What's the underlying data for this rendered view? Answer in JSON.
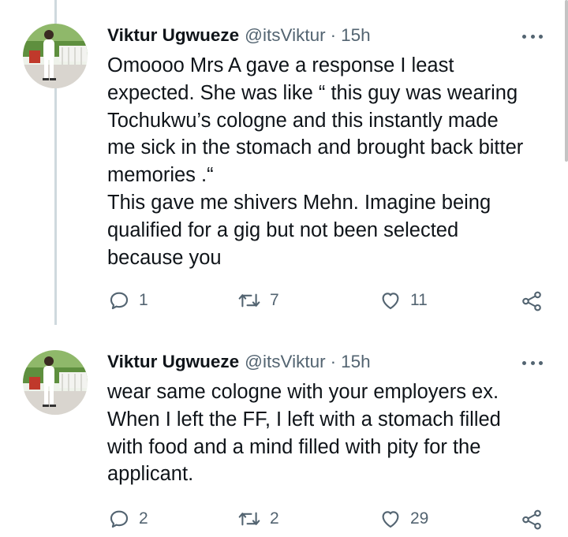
{
  "tweets": [
    {
      "author_name": "Viktur Ugwueze",
      "handle": "@itsViktur",
      "separator": "·",
      "time": "15h",
      "text_lines": [
        "Omoooo Mrs A gave a response I least",
        "expected. She was like “ this guy was wearing",
        "Tochukwu’s cologne and this instantly made",
        "me sick in the stomach and brought back bitter",
        "memories .“",
        "This gave me shivers Mehn. Imagine being",
        "qualified for a gig but not been selected",
        "because you"
      ],
      "replies": "1",
      "retweets": "7",
      "likes": "11"
    },
    {
      "author_name": "Viktur Ugwueze",
      "handle": "@itsViktur",
      "separator": "·",
      "time": "15h",
      "text_lines": [
        "wear same cologne with your employers ex.",
        "When I left the FF, I left with a stomach filled",
        "with food and a mind filled with pity for the",
        "applicant."
      ],
      "replies": "2",
      "retweets": "2",
      "likes": "29"
    }
  ],
  "colors": {
    "text": "#0f1419",
    "secondary": "#536471",
    "thread_line": "#cfd9de"
  },
  "icons": [
    "reply-icon",
    "retweet-icon",
    "like-icon",
    "share-icon",
    "more-icon"
  ]
}
